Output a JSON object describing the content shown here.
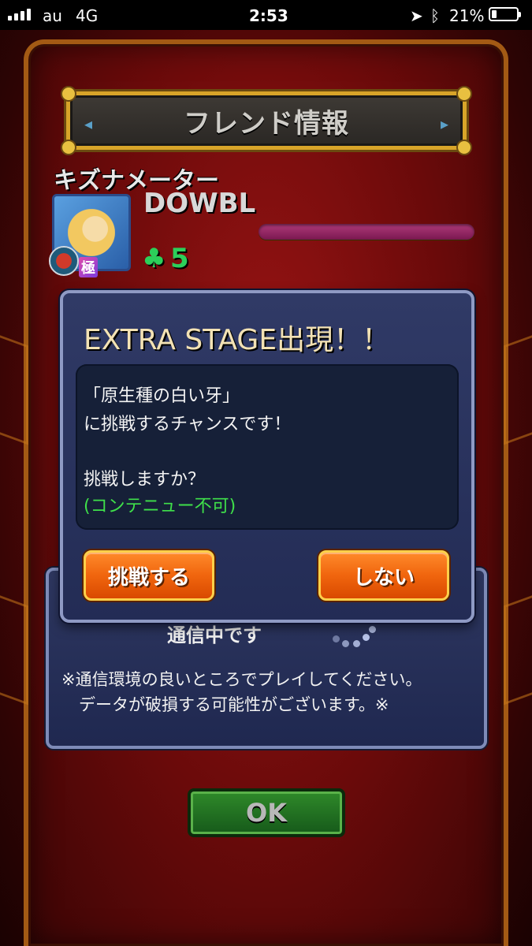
{
  "status_bar": {
    "carrier": "au",
    "network": "4G",
    "time": "2:53",
    "battery": "21%",
    "battery_level": 0.21
  },
  "friend_panel": {
    "title": "フレンド情報",
    "meter_label": "キズナメーター",
    "friend_name": "DOWBL",
    "avatar_badge": "極",
    "clover_count": "5"
  },
  "comm_dialog": {
    "status_text": "通信中です",
    "notice_line1": "※通信環境の良いところでプレイしてください。",
    "notice_line2": "データが破損する可能性がございます。※"
  },
  "ok_button": "OK",
  "modal": {
    "title": "EXTRA STAGE出現！！",
    "line1": "「原生種の白い牙」",
    "line2": "に挑戦するチャンスです！",
    "line3": "挑戦しますか？",
    "line4": "(コンテニュー不可)",
    "accept_label": "挑戦する",
    "decline_label": "しない"
  },
  "colors": {
    "accent_orange": "#f0650e",
    "dialog_navy": "#2a335e",
    "note_green": "#3fe04a",
    "frame_gold": "#d8a429"
  }
}
